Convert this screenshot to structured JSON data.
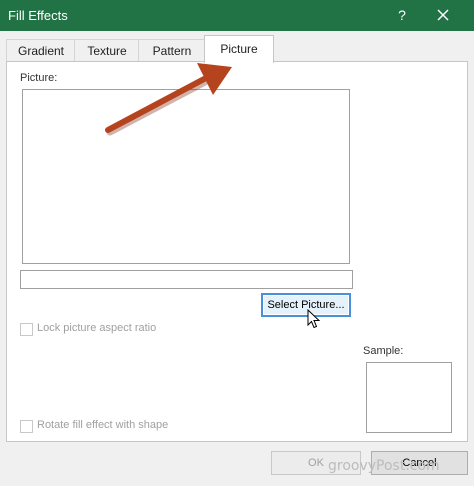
{
  "window": {
    "title": "Fill Effects",
    "help_label": "?"
  },
  "tabs": [
    {
      "label": "Gradient",
      "active": false
    },
    {
      "label": "Texture",
      "active": false
    },
    {
      "label": "Pattern",
      "active": false
    },
    {
      "label": "Picture",
      "active": true
    }
  ],
  "picture": {
    "label": "Picture:",
    "filename_value": "",
    "select_button_label": "Select Picture..."
  },
  "options": {
    "lock_aspect_label": "Lock picture aspect ratio",
    "lock_aspect_checked": false,
    "rotate_label": "Rotate fill effect with shape",
    "rotate_checked": false
  },
  "sample": {
    "label": "Sample:"
  },
  "footer": {
    "ok_label": "OK",
    "cancel_label": "Cancel"
  },
  "watermark": "groovyPost.com",
  "colors": {
    "titlebar": "#217346",
    "annotation_arrow": "#b5431d",
    "focus_border": "#4a90d9"
  },
  "icons": {
    "close": "close-icon",
    "cursor": "mouse-pointer-icon",
    "annotation": "annotation-arrow-icon"
  }
}
